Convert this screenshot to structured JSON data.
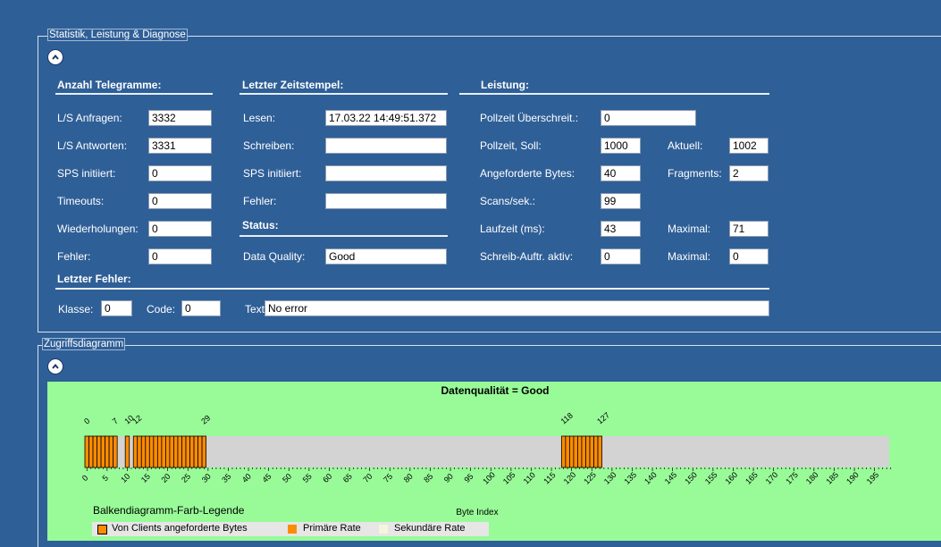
{
  "stats_panel": {
    "legend": "Statistik, Leistung & Diagnose",
    "counts": {
      "header": "Anzahl Telegramme:",
      "rows": [
        {
          "label": "L/S Anfragen:",
          "value": "3332"
        },
        {
          "label": "L/S Antworten:",
          "value": "3331"
        },
        {
          "label": "SPS initiiert:",
          "value": "0"
        },
        {
          "label": "Timeouts:",
          "value": "0"
        },
        {
          "label": "Wiederholungen:",
          "value": "0"
        },
        {
          "label": "Fehler:",
          "value": "0"
        }
      ]
    },
    "timestamp": {
      "header": "Letzter Zeitstempel:",
      "rows": [
        {
          "label": "Lesen:",
          "value": "17.03.22 14:49:51.372"
        },
        {
          "label": "Schreiben:",
          "value": ""
        },
        {
          "label": "SPS initiiert:",
          "value": ""
        },
        {
          "label": "Fehler:",
          "value": ""
        }
      ],
      "status_header": "Status:",
      "quality_label": "Data Quality:",
      "quality_value": "Good"
    },
    "performance": {
      "header": "Leistung:",
      "poll_exceed_label": "Pollzeit Überschreit.:",
      "poll_exceed_value": "0",
      "poll_target_label": "Pollzeit, Soll:",
      "poll_target_value": "1000",
      "current_label": "Aktuell:",
      "current_value": "1002",
      "bytes_label": "Angeforderte Bytes:",
      "bytes_value": "40",
      "fragments_label": "Fragments:",
      "fragments_value": "2",
      "scans_label": "Scans/sek.:",
      "scans_value": "99",
      "runtime_label": "Laufzeit (ms):",
      "runtime_value": "43",
      "runtime_max_label": "Maximal:",
      "runtime_max_value": "71",
      "write_label": "Schreib-Auftr. aktiv:",
      "write_value": "0",
      "write_max_label": "Maximal:",
      "write_max_value": "0"
    },
    "last_error": {
      "header": "Letzter Fehler:",
      "class_label": "Klasse:",
      "class_value": "0",
      "code_label": "Code:",
      "code_value": "0",
      "text_label": "Text:",
      "text_value": "No error"
    }
  },
  "access_panel": {
    "legend": "Zugriffsdiagramm"
  },
  "chart_data": {
    "type": "bar",
    "title": "Datenqualität = Good",
    "xlabel": "Byte Index",
    "xlim": [
      0,
      199
    ],
    "x_ticks": [
      0,
      5,
      10,
      15,
      20,
      25,
      30,
      35,
      40,
      45,
      50,
      55,
      60,
      65,
      70,
      75,
      80,
      85,
      90,
      95,
      100,
      105,
      110,
      115,
      120,
      125,
      130,
      135,
      140,
      145,
      150,
      155,
      160,
      165,
      170,
      175,
      180,
      185,
      190,
      195
    ],
    "requested_ranges": [
      {
        "start": 0,
        "end": 7,
        "start_label": "0",
        "end_label": "7"
      },
      {
        "start": 10,
        "end": 10,
        "start_label": "10",
        "end_label": ""
      },
      {
        "start": 12,
        "end": 29,
        "start_label": "12",
        "end_label": "29"
      },
      {
        "start": 118,
        "end": 127,
        "start_label": "118",
        "end_label": "127"
      }
    ],
    "range_labels": [
      "0",
      "7",
      "10",
      "12",
      "29",
      "118",
      "127"
    ],
    "colors": {
      "requested": "#ff8c00",
      "primary": "#ff8c00",
      "secondary": "#f5f5dc",
      "background": "#d3d3d3",
      "plot_bg": "#98fb98"
    },
    "legend": {
      "title": "Balkendiagramm-Farb-Legende",
      "items": [
        {
          "label": "Von Clients angeforderte Bytes",
          "color": "#ff8c00"
        },
        {
          "label": "Primäre Rate",
          "color": "#ff8c00"
        },
        {
          "label": "Sekundäre Rate",
          "color": "#f5f5dc"
        }
      ]
    }
  }
}
